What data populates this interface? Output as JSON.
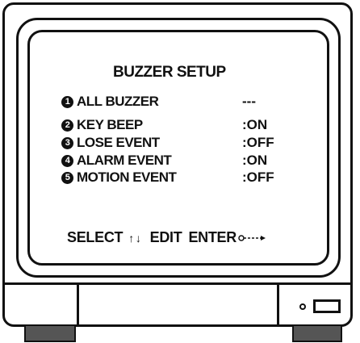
{
  "menu": {
    "title": "BUZZER SETUP",
    "items": [
      {
        "num": "1",
        "label": "ALL BUZZER",
        "value": "---"
      },
      {
        "num": "2",
        "label": "KEY BEEP",
        "value": ":ON"
      },
      {
        "num": "3",
        "label": "LOSE EVENT",
        "value": ":OFF"
      },
      {
        "num": "4",
        "label": "ALARM EVENT",
        "value": ":ON"
      },
      {
        "num": "5",
        "label": "MOTION EVENT",
        "value": ":OFF"
      }
    ]
  },
  "footer": {
    "select_label": "SELECT",
    "edit_label": "EDIT",
    "enter_label": "ENTER",
    "up_arrow": "↑",
    "down_arrow": "↓"
  },
  "icons": {
    "led": "indicator-led-icon",
    "power": "power-button-icon",
    "enter": "enter-arrow-icon"
  }
}
